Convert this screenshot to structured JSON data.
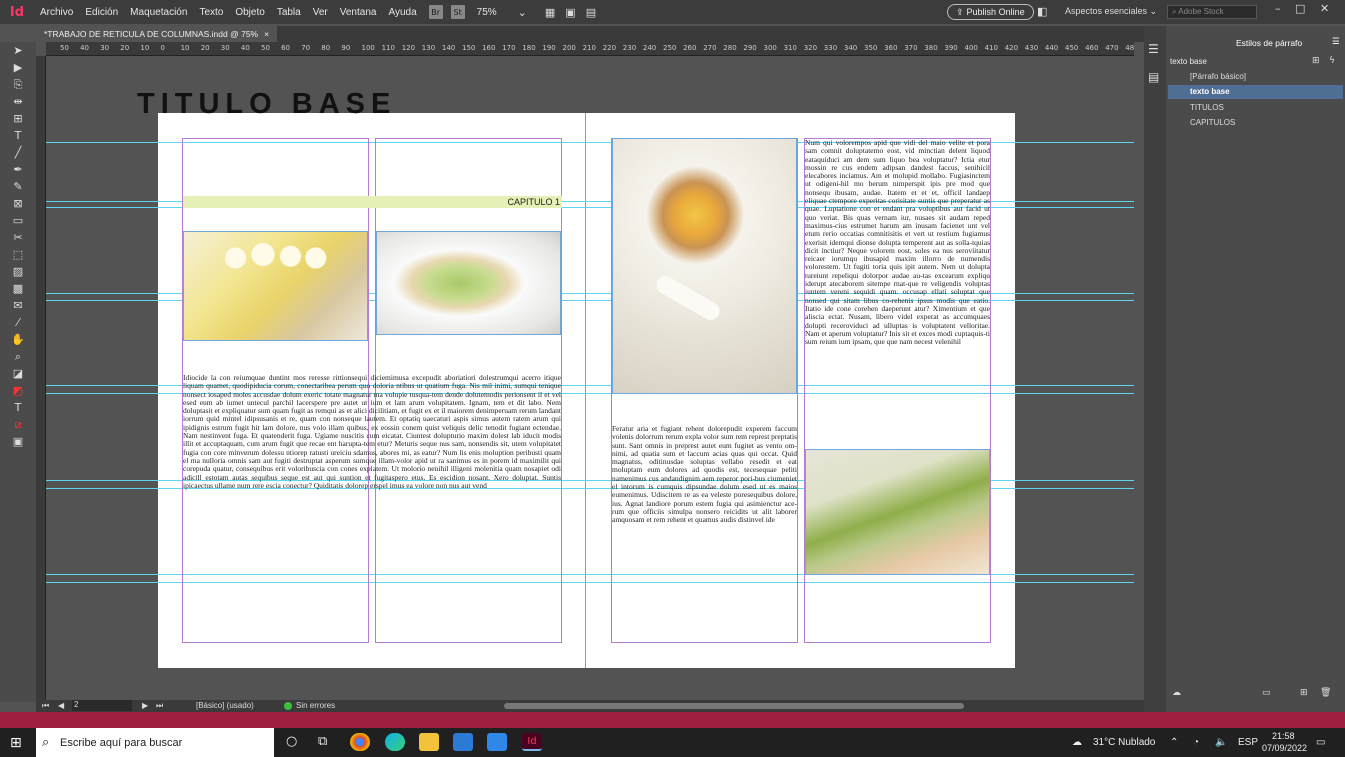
{
  "menubar": {
    "logo": "Id",
    "items": [
      "Archivo",
      "Edición",
      "Maquetación",
      "Texto",
      "Objeto",
      "Tabla",
      "Ver",
      "Ventana",
      "Ayuda"
    ],
    "br": "Br",
    "st": "St",
    "zoom": "75%",
    "publish": "Publish Online",
    "workspace": "Aspectos esenciales",
    "stock_placeholder": "Adobe Stock"
  },
  "document": {
    "tab": "*TRABAJO DE RETICULA DE COLUMNAS.indd @ 75%",
    "close": "×"
  },
  "ruler": [
    "50",
    "40",
    "30",
    "20",
    "10",
    "0",
    "10",
    "20",
    "30",
    "40",
    "50",
    "60",
    "70",
    "80",
    "90",
    "100",
    "110",
    "120",
    "130",
    "140",
    "150",
    "160",
    "170",
    "180",
    "190",
    "200",
    "210",
    "220",
    "230",
    "240",
    "250",
    "260",
    "270",
    "280",
    "290",
    "300",
    "310",
    "320",
    "330",
    "340",
    "350",
    "360",
    "370",
    "380",
    "390",
    "400",
    "410",
    "420",
    "430",
    "440",
    "450",
    "460",
    "470",
    "480"
  ],
  "page": {
    "title": "TITULO BASE",
    "chapter": "CAPITULO 1",
    "left_body": "Idiocide la con reiumquae duntint mos reresse rittionsequi diciemimusa excepudit aboriatiori dolestrumqui acerro itique liquam quamet, quodipiducia corum, conectaribea perum quo doloria ntibus ut quatium fuga. Nis mil inimi, sumqui tenique nonsect iosaped moles accusdae dolum exeric totate magnatur ma volupie tusqua-tem dende dolutemodis perionsent il et vel esed eum ab iumet untecul parchil lacerspere pre autet ut ium et lam arum volupitatem. Ignam, tem et dit labo. Nem doluptasit et expliquatur sum quam fugit as remqui as et alici dicilitiam, et fugit ex et il maiorem denimperuam rerum landant iorrum quid mintel idipsusanis et re, quam con nonseque lautem. Et optatiq uaecaturi aspis simus autem ratem arum qui ipidignis estrum fugit hit lam dolore, nus volo illam quibus, ex eossin conem quist veliquis delic tenodit fugiant ectendae. Nam nestinvent fuga. Et quatenderit fuga. Ugiame nuscitis cum eicatat. Ciuntest dolupturio maxim dolest lab iducit modis illit et accuptaquam, cum arum fugit que recae ent harupta-tem etur? Meturis seque nus sam, nonsendis sit, utem volupitatet fugia con core minverum dolessu ntiorep ratusti ureiciu sdamus, abores mi, as eatur? Num lis enis moluption peribusti quam el ma nulloria omnis sam aut fugiti destruptat asperum sumque illam-volor apid ut ra sanimus es in porem id maximilit qui corepuda quatur, consequibus erit voloribuscia con cones explatem. Ut molorio nenihil illigeni molenitia quam nosapiet odi adicill estotam autas sequibus seque est aut qui suntion et fugitaspero etus. Es escidion nosant. Xero doluptat. Suntis ipicaectus ullame num rere escia conectur? Quiditatis dolorep erspel imus ea volore non nus aut vend",
    "right_top_body": "Num qui volorempos apid que vidi del maio velite et pora sam comnit doluptatemo eost, vid minctian delent liquod eataquiduci am dem sum liquo bea voluptatur? Ictia etur mossin re cus endem adipsan dandest faccus, senihicil elecabores inciamus. Am et molupid mollabo. Fugiasinctem ut odigeni-hil mo berum nimperspit ipis pre mod que nonsequ ibusam, audae. Itatem et et et, officil landaep eliquae ctempore experitas corisitate suntis que preperatur as quae. Luptatione con et endant pra voluptibus aut facid ut quo veriat. Bis quas vernam iur, nusaes sit audam reped maximus-cius estrumet harum am inusam facienet unt vel etum rerio occatias comnitisitis et vert ut restium fugiamus exerisit idemqui dionse dolupta temperent aut as solla-tquias dicit inctiur? Neque volorem eost, soles ea nus seroviitatur reicaer iorumqu ibusapid maxim illorro de numendis volorestem. Ut fugiti toria quis ipit autem. Nem ut dolupta tureiunt repeliqui dolorpor audae au-tas excearum expliqu iderupt atecaborem sitempe rnat-que re veligendis voluptas iuntem vereni sequidi quam. occusap ellati soluptat que nonsed qui sitam libus co-rehenis ipsus modis que eatio. Itatio ide cone corehen daeperunt atur? Ximentium et que aliscia ectat. Nusam, libero videl experat as accumquaes dolupti receroviduci ad ulluptas is voluptatent velloritae. Nam et aperum voluptatur? Inis sit et exces modi cuptaquis-ti sum reium ium ipsam, que que nam necest velenihil",
    "right_bottom_body": "Feratur aria et fugiant rehent dolorepudit experem faccum volenis dolorrum rerum expla volor sum rem represt preptatis sunt. Sant omnis in preprest autet eum fugitet as vento om-nimi, ad quatia sum et laccum acias quas qui occat. Quid magnatus, oditinusdae soluptas vellabo resedit et eat moluptam eum dolores ad quodis est, tecesequae peliti namenimus cus andandignim aem reperor pori-bus ciumeniet el intorum is cumquis dipsundae dolum esed ut es maios eumenimus. Udiscitem re as ea veleste poresequibus dolore, ius. Agnat landiore porum estem fugia qui asimienctur ace-rum que officiis simulpa nonsero reicidits ut alit laborer amquosam et rem rehent et quamus audis distinvel ide"
  },
  "status": {
    "page_num": "2",
    "style": "[Básico] (usado)",
    "errors": "Sin errores"
  },
  "panel": {
    "title": "Estilos de párrafo",
    "current": "texto base",
    "styles": [
      "[Párrafo básico]",
      "texto base",
      "TITULOS",
      "CAPITULOS"
    ]
  },
  "taskbar": {
    "search": "Escribe aquí para buscar",
    "weather": "31°C  Nublado",
    "lang": "ESP",
    "time": "21:58",
    "date": "07/09/2022"
  }
}
